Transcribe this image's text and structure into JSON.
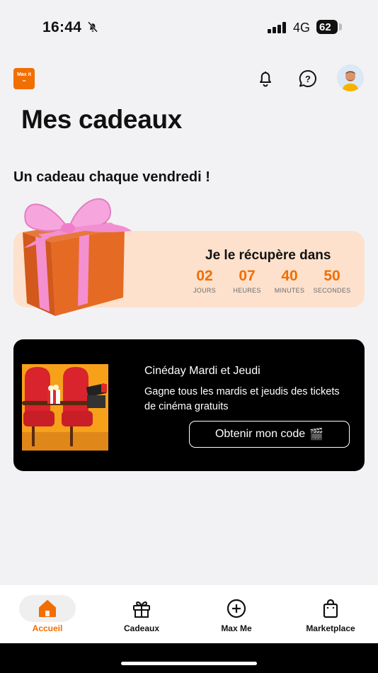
{
  "status_bar": {
    "time": "16:44",
    "network": "4G",
    "battery": "62"
  },
  "header": {
    "logo_text": "Max it",
    "logo_sub": "oa"
  },
  "page": {
    "title": "Mes cadeaux",
    "weekly_title": "Un cadeau chaque vendredi !"
  },
  "countdown": {
    "label": "Je le récupère dans",
    "units": [
      {
        "value": "02",
        "label": "JOURS"
      },
      {
        "value": "07",
        "label": "HEURES"
      },
      {
        "value": "40",
        "label": "MINUTES"
      },
      {
        "value": "50",
        "label": "SECONDES"
      }
    ]
  },
  "promo": {
    "title": "Cinéday Mardi et Jeudi",
    "description": "Gagne tous les mardis et jeudis des tickets de cinéma gratuits",
    "button_label": "Obtenir mon code",
    "button_icon": "🎬"
  },
  "nav": {
    "items": [
      {
        "label": "Accueil",
        "icon": "home-icon",
        "active": true
      },
      {
        "label": "Cadeaux",
        "icon": "gift-icon",
        "active": false
      },
      {
        "label": "Max Me",
        "icon": "plus-circle-icon",
        "active": false
      },
      {
        "label": "Marketplace",
        "icon": "shopping-bag-icon",
        "active": false
      }
    ]
  },
  "colors": {
    "accent": "#f16e00",
    "card_bg": "#fde1cc",
    "page_bg": "#f2f2f4"
  }
}
